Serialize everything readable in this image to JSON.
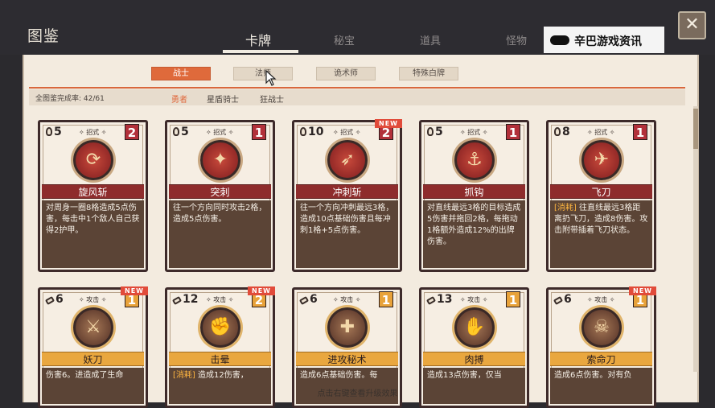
{
  "header": {
    "title": "图鉴",
    "tabs": [
      {
        "label": "卡牌",
        "active": true
      },
      {
        "label": "秘宝",
        "active": false
      },
      {
        "label": "道具",
        "active": false
      },
      {
        "label": "怪物",
        "active": false
      }
    ],
    "close_label": "✕"
  },
  "watermark": {
    "text": "辛巴游戏资讯"
  },
  "class_tabs": [
    {
      "label": "战士",
      "active": true
    },
    {
      "label": "法师",
      "active": false
    },
    {
      "label": "诡术师",
      "active": false
    },
    {
      "label": "特殊白牌",
      "active": false
    }
  ],
  "progress": {
    "text": "全图鉴完成率: 42/61",
    "completed": 42,
    "total": 61
  },
  "filters": [
    {
      "label": "勇者",
      "active": true
    },
    {
      "label": "星盾骑士",
      "active": false
    },
    {
      "label": "狂战士",
      "active": false
    }
  ],
  "cards_row1": [
    {
      "cost": "5",
      "type": "招式",
      "level": "2",
      "name": "旋风斩",
      "icon": "whirlwind-slash-icon",
      "glyph": "⟳",
      "new": "",
      "desc_kw": "",
      "desc": "对周身一圈8格造成5点伤害，每击中1个敌人自己获得2护甲。"
    },
    {
      "cost": "5",
      "type": "招式",
      "level": "1",
      "name": "突刺",
      "icon": "thrust-icon",
      "glyph": "✦",
      "new": "",
      "desc_kw": "",
      "desc": "往一个方向同时攻击2格，造成5点伤害。"
    },
    {
      "cost": "10",
      "type": "招式",
      "level": "2",
      "name": "冲刺斩",
      "icon": "dash-slash-icon",
      "glyph": "➶",
      "new": "NEW",
      "desc_kw": "",
      "desc": "往一个方向冲刺最远3格，造成10点基础伤害且每冲刺1格+5点伤害。"
    },
    {
      "cost": "5",
      "type": "招式",
      "level": "1",
      "name": "抓钩",
      "icon": "grappling-hook-icon",
      "glyph": "⚓",
      "new": "",
      "desc_kw": "",
      "desc": "对直线最远3格的目标造成5伤害并拖回2格，每拖动1格额外造成12%的出牌伤害。"
    },
    {
      "cost": "8",
      "type": "招式",
      "level": "1",
      "name": "飞刀",
      "icon": "flying-knife-icon",
      "glyph": "✈",
      "new": "",
      "desc_kw": "[消耗]",
      "desc": "往直线最远3格距离扔飞刀，造成8伤害。攻击附带插着飞刀状态。"
    }
  ],
  "cards_row2": [
    {
      "cost": "6",
      "type": "攻击",
      "level": "1",
      "name": "妖刀",
      "icon": "demon-blade-icon",
      "glyph": "⚔",
      "new": "NEW",
      "desc_kw": "",
      "desc": "伤害6。进造成了生命"
    },
    {
      "cost": "12",
      "type": "攻击",
      "level": "2",
      "name": "击晕",
      "icon": "stun-icon",
      "glyph": "✊",
      "new": "NEW",
      "desc_kw": "[消耗]",
      "desc": "造成12伤害，"
    },
    {
      "cost": "6",
      "type": "攻击",
      "level": "1",
      "name": "进攻秘术",
      "icon": "attack-arcana-icon",
      "glyph": "✚",
      "new": "",
      "desc_kw": "",
      "desc": "造成6点基础伤害。每"
    },
    {
      "cost": "13",
      "type": "攻击",
      "level": "1",
      "name": "肉搏",
      "icon": "brawl-icon",
      "glyph": "✋",
      "new": "",
      "desc_kw": "",
      "desc": "造成13点伤害，仅当"
    },
    {
      "cost": "6",
      "type": "攻击",
      "level": "1",
      "name": "索命刀",
      "icon": "death-blade-icon",
      "glyph": "☠",
      "new": "NEW",
      "desc_kw": "",
      "desc": "造成6点伤害。对有负"
    }
  ],
  "footer": {
    "hint": "点击右键查看升级效果"
  }
}
